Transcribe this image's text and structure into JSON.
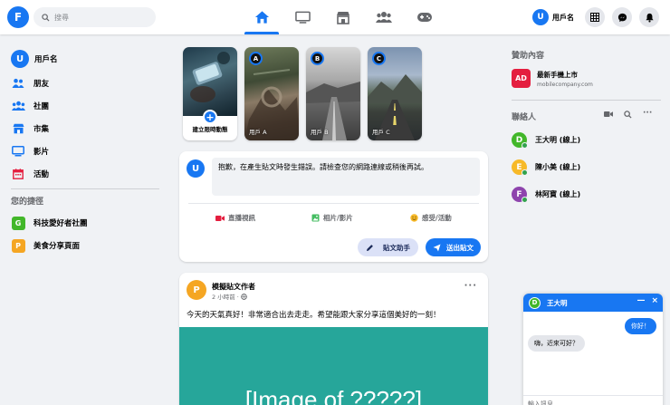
{
  "topbar": {
    "logo": "F",
    "search_placeholder": "搜尋",
    "nav": [
      "home-icon",
      "watch-icon",
      "marketplace-icon",
      "groups-icon",
      "gaming-icon"
    ],
    "user_initial": "U",
    "user_name": "用戶名",
    "right_icons": [
      "menu-grid-icon",
      "messenger-icon",
      "bell-icon"
    ],
    "accent": "#1877f2"
  },
  "sidebar": {
    "profile_initial": "U",
    "profile_name": "用戶名",
    "items": [
      {
        "label": "朋友",
        "icon": "friends-icon"
      },
      {
        "label": "社團",
        "icon": "groups-icon"
      },
      {
        "label": "市集",
        "icon": "marketplace-icon"
      },
      {
        "label": "影片",
        "icon": "watch-icon"
      },
      {
        "label": "活動",
        "icon": "calendar-icon"
      }
    ],
    "shortcuts_title": "您的捷徑",
    "shortcuts": [
      {
        "initial": "G",
        "label": "科技愛好者社團",
        "color": "#42b72a"
      },
      {
        "initial": "P",
        "label": "美食分享頁面",
        "color": "#f5a623"
      }
    ]
  },
  "stories": {
    "create_label": "建立限時動態",
    "items": [
      {
        "initial": "A",
        "name": "用戶 A"
      },
      {
        "initial": "B",
        "name": "用戶 B"
      },
      {
        "initial": "C",
        "name": "用戶 C"
      }
    ]
  },
  "composer": {
    "avatar_initial": "U",
    "error_text": "抱歉，在產生貼文時發生錯誤。請檢查您的網路連線或稍後再試。",
    "actions": [
      "直播視訊",
      "相片/影片",
      "感受/活動"
    ],
    "assist_label": "貼文助手",
    "send_label": "送出貼文"
  },
  "post": {
    "avatar_initial": "P",
    "author": "模擬貼文作者",
    "time": "2 小時前 ·",
    "more": "···",
    "body": "今天的天氣真好！非常適合出去走走。希望能跟大家分享這個美好的一刻！",
    "image_text": "[Image of ?????]"
  },
  "right": {
    "sponsored_title": "贊助內容",
    "ad_initials": "AD",
    "ad_title": "最新手機上市",
    "ad_domain": "mobilecompany.com",
    "contacts_title": "聯絡人",
    "contacts": [
      {
        "initial": "D",
        "name": "王大明 (線上)",
        "color": "#42b72a"
      },
      {
        "initial": "E",
        "name": "陳小美 (線上)",
        "color": "#f7b928"
      },
      {
        "initial": "F",
        "name": "林阿寶 (線上)",
        "color": "#8e44ad"
      }
    ]
  },
  "chat": {
    "initial": "D",
    "name": "王大明",
    "minimize": "—",
    "close": "×",
    "messages": [
      {
        "from": "me",
        "text": "你好！"
      },
      {
        "from": "them",
        "text": "嗨，近來可好？"
      }
    ],
    "input_placeholder": "輸入訊息..."
  }
}
